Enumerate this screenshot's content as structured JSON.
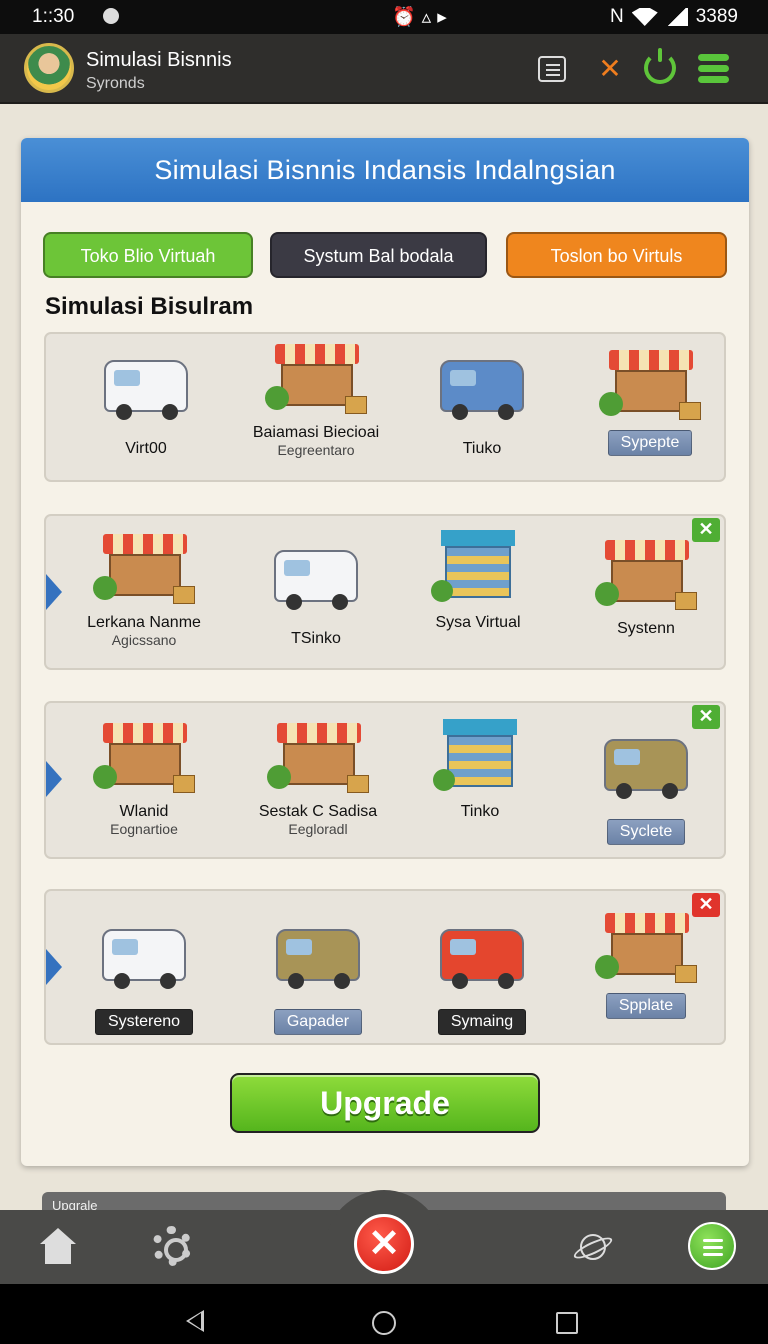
{
  "status_bar": {
    "time": "1::30",
    "battery": "3389"
  },
  "app_header": {
    "title": "Simulasi Bisnnis",
    "subtitle": "Syronds"
  },
  "card": {
    "title": "Simulasi Bisnnis Indansis Indalngsian",
    "tabs": [
      {
        "label": "Toko Blio Virtuah",
        "color": "#6dc538"
      },
      {
        "label": "Systum Bal bodala",
        "color": "#3b3a44"
      },
      {
        "label": "Toslon bo Virtuls",
        "color": "#ef861e"
      }
    ],
    "section_title": "Simulasi Bisulram",
    "rows": [
      {
        "items": [
          {
            "icon": "van-icon",
            "name": "Virt00"
          },
          {
            "icon": "stall-icon",
            "name": "Baiamasi Biecioai",
            "sub": "Eegreentaro"
          },
          {
            "icon": "van-icon",
            "name": "Tiuko"
          },
          {
            "icon": "stall-icon",
            "button": "Sypepte"
          }
        ]
      },
      {
        "badge": "✕",
        "items": [
          {
            "icon": "stall-icon",
            "name": "Lerkana Nanme",
            "sub": "Agicssano"
          },
          {
            "icon": "van-icon",
            "name": "TSinko"
          },
          {
            "icon": "shop-icon",
            "name": "Sysa Virtual"
          },
          {
            "icon": "stall-icon",
            "name": "Systenn"
          }
        ]
      },
      {
        "badge": "✕",
        "items": [
          {
            "icon": "stall-icon",
            "name": "Wlanid",
            "sub": "Eognartioe"
          },
          {
            "icon": "stall-icon",
            "name": "Sestak C Sadisa",
            "sub": "Eegloradl"
          },
          {
            "icon": "shop-icon",
            "name": "Tinko"
          },
          {
            "icon": "van-icon",
            "button": "Syclete"
          }
        ]
      },
      {
        "badge": "✕",
        "items": [
          {
            "icon": "van-icon",
            "button": "Systereno"
          },
          {
            "icon": "van-icon",
            "button": "Gapader"
          },
          {
            "icon": "van-icon",
            "button": "Symaing"
          },
          {
            "icon": "stall-icon",
            "button": "Spplate"
          }
        ]
      }
    ],
    "upgrade_label": "Upgrade"
  },
  "strip_label": "Upgrale",
  "bottom_nav": {
    "close_label": "✕"
  }
}
